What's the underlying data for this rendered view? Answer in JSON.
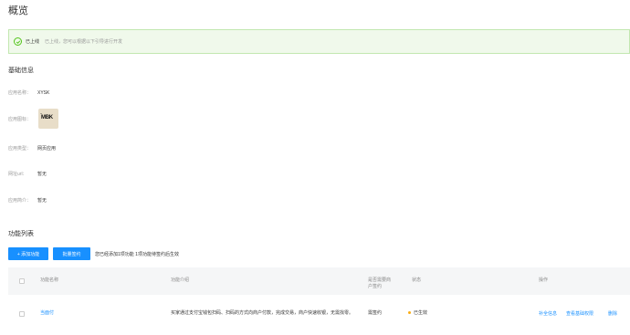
{
  "page": {
    "title": "概览"
  },
  "banner": {
    "status_label": "已上线",
    "status_desc": "已上线，您可以根据以下引导进行开发",
    "color": "#52c41a"
  },
  "basic_info": {
    "title": "基础信息",
    "rows": [
      {
        "label": "应用名称：",
        "value": "XYSK"
      },
      {
        "label": "应用图标：",
        "value": ""
      },
      {
        "label": "应用类型：",
        "value": "网页应用"
      },
      {
        "label": "网址url：",
        "value": "暂无"
      },
      {
        "label": "应用简介：",
        "value": "暂无"
      }
    ],
    "icon_brand": "MBK"
  },
  "features": {
    "title": "功能列表",
    "add_button": "+ 添加功能",
    "batch_sign_button": "批量签约",
    "tip": "您已经添加1项功能  1项功能待签约后生效",
    "columns": [
      "功能名称",
      "功能介绍",
      "是否需要商户签约",
      "状态",
      "操作"
    ],
    "rows": [
      {
        "name": "当面付",
        "desc": "买家通过支付宝钱包扫码、扫码的方式向商户付款，完成交易，商户快速收银，无需找零。",
        "need_sign": "需签约",
        "status": "已生效",
        "actions": [
          "补全信息",
          "查看基础权限",
          "删除"
        ]
      }
    ]
  },
  "colors": {
    "accent": "#1890ff",
    "success": "#52c41a",
    "pending": "#faad14"
  }
}
